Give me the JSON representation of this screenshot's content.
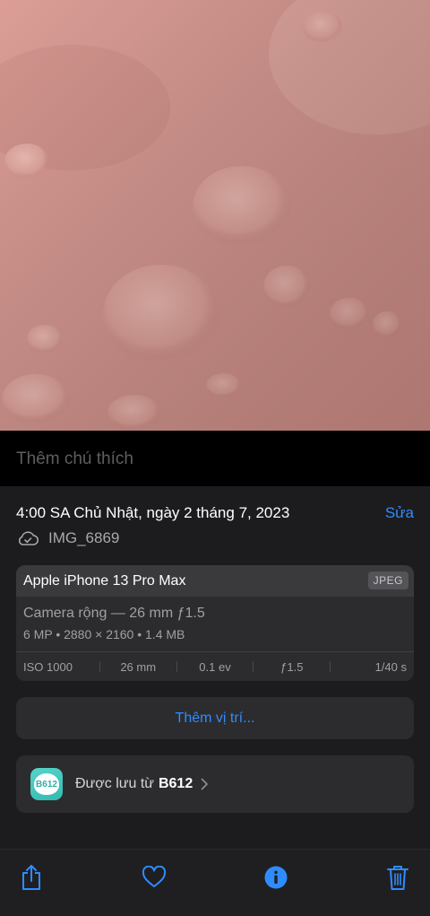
{
  "caption": {
    "placeholder": "Thêm chú thích"
  },
  "info": {
    "datetime": "4:00 SA Chủ Nhật, ngày 2 tháng 7, 2023",
    "edit_label": "Sửa",
    "filename": "IMG_6869",
    "cloud_icon": "cloud-icon"
  },
  "exif": {
    "device": "Apple iPhone 13 Pro Max",
    "format": "JPEG",
    "lens": "Camera rộng — 26 mm ƒ1.5",
    "specs": "6 MP  •  2880 × 2160  •  1.4 MB",
    "iso": "ISO 1000",
    "focal_length": "26 mm",
    "exposure_value": "0.1 ev",
    "aperture": "ƒ1.5",
    "shutter": "1/40 s"
  },
  "location": {
    "label": "Thêm vị trí..."
  },
  "source": {
    "prefix": "Được lưu từ",
    "app_name": "B612",
    "app_icon_text": "B612"
  },
  "toolbar": {
    "share_icon": "share-icon",
    "favorite_icon": "heart-icon",
    "info_icon": "info-icon",
    "delete_icon": "trash-icon",
    "accent_color": "#2f8cff"
  }
}
